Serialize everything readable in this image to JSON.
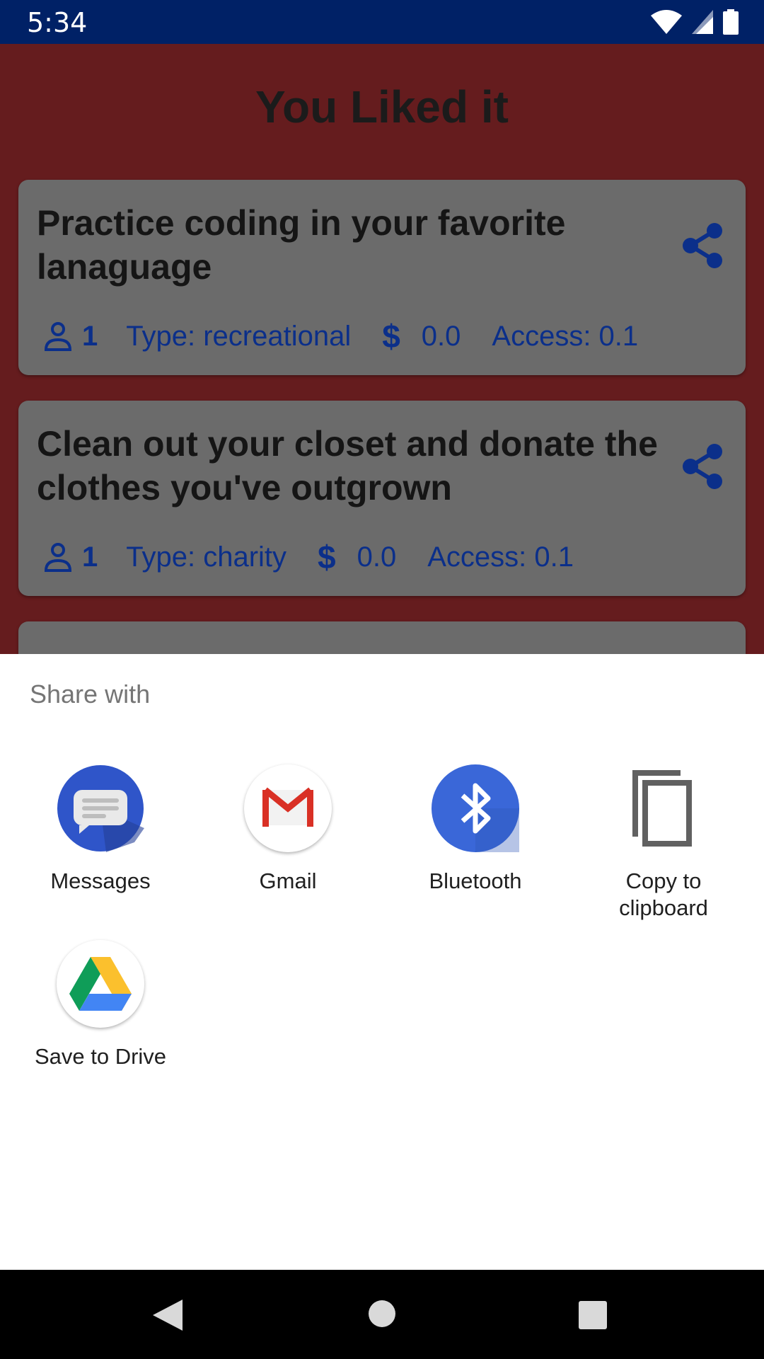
{
  "status_bar": {
    "time": "5:34"
  },
  "app": {
    "title": "You Liked it",
    "cards": [
      {
        "title": "Practice coding in your favorite lanaguage",
        "participants": "1",
        "type": "Type: recreational",
        "price": "0.0",
        "access": "Access: 0.1"
      },
      {
        "title": "Clean out your closet and donate the clothes you've outgrown",
        "participants": "1",
        "type": "Type: charity",
        "price": "0.0",
        "access": "Access: 0.1"
      }
    ],
    "currency_symbol": "$"
  },
  "share_sheet": {
    "title": "Share with",
    "targets": [
      {
        "label": "Messages",
        "icon": "messages-icon"
      },
      {
        "label": "Gmail",
        "icon": "gmail-icon"
      },
      {
        "label": "Bluetooth",
        "icon": "bluetooth-icon"
      },
      {
        "label": "Copy to clipboard",
        "icon": "copy-icon"
      },
      {
        "label": "Save to Drive",
        "icon": "drive-icon"
      }
    ]
  },
  "colors": {
    "status_bar": "#002166",
    "app_background": "#651c1e",
    "card_background": "#6b6b6b",
    "meta_text": "#0b2f8a"
  }
}
